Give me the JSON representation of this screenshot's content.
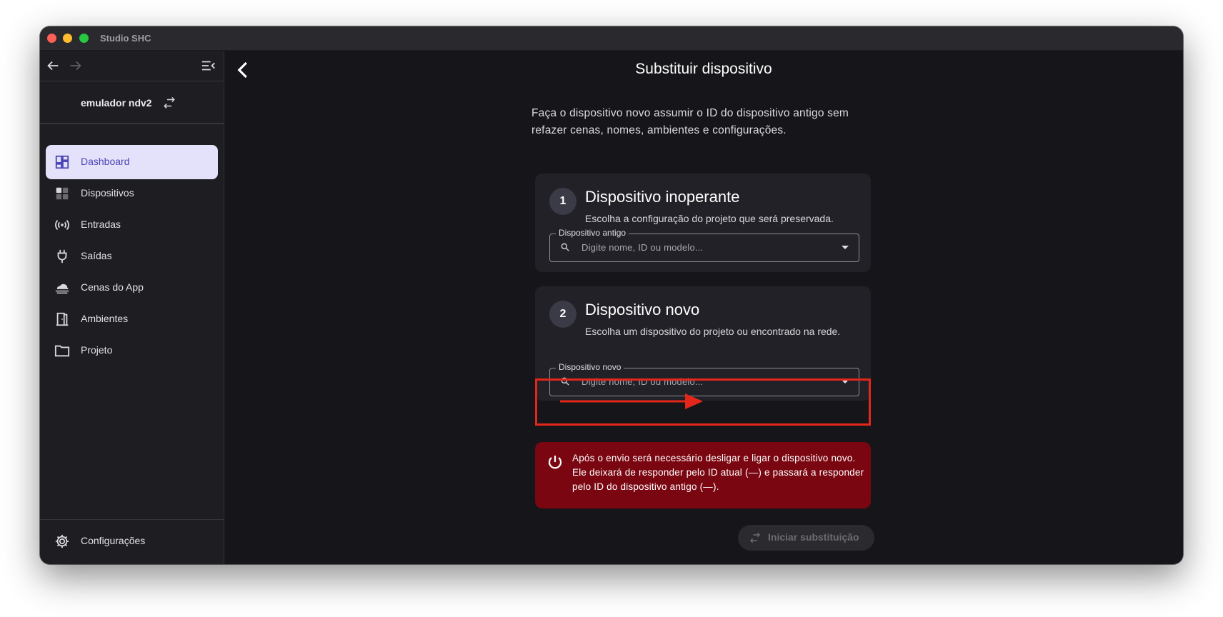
{
  "window": {
    "title": "Studio SHC"
  },
  "sidebar": {
    "account_name": "emulador ndv2",
    "items": [
      {
        "label": "Dashboard",
        "icon": "dashboard-icon",
        "active": true
      },
      {
        "label": "Dispositivos",
        "icon": "devices-icon",
        "active": false
      },
      {
        "label": "Entradas",
        "icon": "broadcast-icon",
        "active": false
      },
      {
        "label": "Saídas",
        "icon": "plug-icon",
        "active": false
      },
      {
        "label": "Cenas do App",
        "icon": "cloud-icon",
        "active": false
      },
      {
        "label": "Ambientes",
        "icon": "door-icon",
        "active": false
      },
      {
        "label": "Projeto",
        "icon": "folder-icon",
        "active": false
      }
    ],
    "settings_label": "Configurações"
  },
  "main": {
    "title": "Substituir dispositivo",
    "intro": "Faça o dispositivo novo assumir o ID do dispositivo antigo sem refazer cenas, nomes, ambientes e configurações.",
    "step1": {
      "number": "1",
      "title": "Dispositivo inoperante",
      "subtitle": "Escolha a configuração do projeto que será preservada.",
      "field_label": "Dispositivo antigo",
      "placeholder": "Digite nome, ID ou modelo..."
    },
    "step2": {
      "number": "2",
      "title": "Dispositivo novo",
      "subtitle": "Escolha um dispositivo do projeto ou encontrado na rede.",
      "field_label": "Dispositivo novo",
      "placeholder": "Digite nome, ID ou modelo..."
    },
    "alert": "Após o envio será necessário desligar e ligar o dispositivo novo. Ele deixará de responder pelo ID atual (—) e passará a responder pelo ID do dispositivo antigo (—).",
    "start_button": "Iniciar substituição"
  },
  "colors": {
    "accent": "#4b45b8",
    "active_bg": "#e4e2fa",
    "alert_bg": "#7a0611",
    "highlight": "#e5261a"
  }
}
